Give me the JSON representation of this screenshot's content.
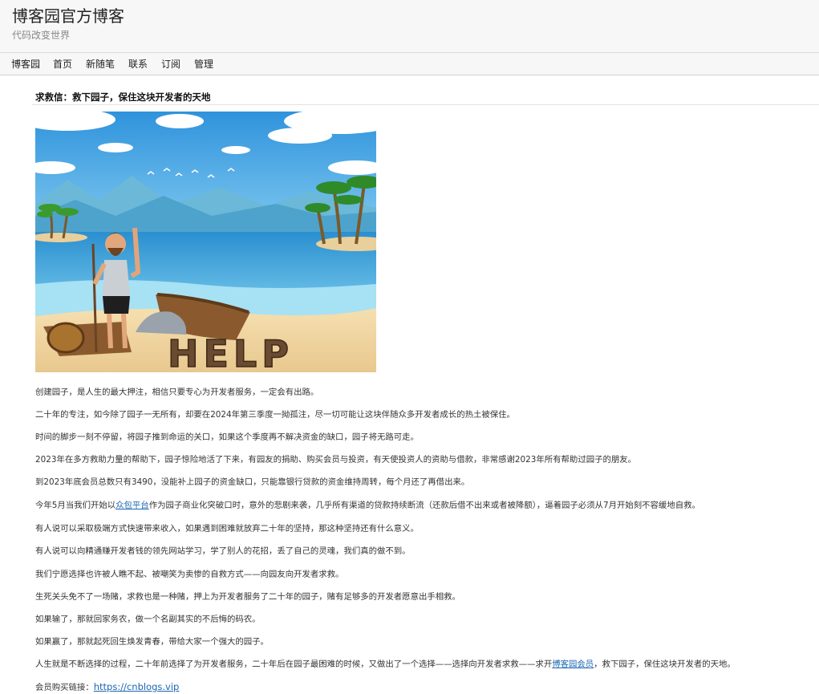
{
  "header": {
    "title": "博客园官方博客",
    "subtitle": "代码改变世界"
  },
  "nav": {
    "items": [
      "博客园",
      "首页",
      "新随笔",
      "联系",
      "订阅",
      "管理"
    ]
  },
  "post": {
    "title": "求救信：救下园子，保住这块开发者的天地",
    "image_text": "HELP",
    "paragraphs": [
      "创建园子，是人生的最大押注，相信只要专心为开发者服务，一定会有出路。",
      "二十年的专注，如今除了园子一无所有，却要在2024年第三季度一拗孤注，尽一切可能让这块伴随众多开发者成长的热土被保住。",
      "时间的脚步一刻不停留，将园子推到命运的关口，如果这个季度再不解决资金的缺口，园子将无路可走。",
      "2023年在多方救助力量的帮助下，园子惊险地活了下来，有园友的捐助、购买会员与投资，有天使投资人的资助与借款，非常感谢2023年所有帮助过园子的朋友。",
      "到2023年底会员总数只有3490，没能补上园子的资金缺口，只能靠银行贷款的资金维持周转，每个月还了再借出来。"
    ],
    "p6": {
      "before": "今年5月当我们开始以",
      "link": "众包平台",
      "after": "作为园子商业化突破口时，意外的悲剧来袭，几乎所有渠道的贷款持续断流（还款后借不出来或者被降额），逼着园子必须从7月开始刻不容缓地自救。"
    },
    "paragraphs2": [
      "有人说可以采取极端方式快速带来收入，如果遇到困难就放弃二十年的坚持，那这种坚持还有什么意义。",
      "有人说可以向精通赚开发者钱的领先网站学习，学了别人的花招，丢了自己的灵魂，我们真的做不到。",
      "我们宁愿选择也许被人瞧不起、被嘲笑为卖惨的自救方式——向园友向开发者求救。",
      "生死关头免不了一场赌，求救也是一种赌，押上为开发者服务了二十年的园子，赌有足够多的开发者愿意出手相救。",
      "如果输了，那就回家务农，做一个名副其实的不后悔的码农。",
      "如果赢了，那就起死回生焕发青春，带给大家一个强大的园子。"
    ],
    "p13": {
      "before": "人生就是不断选择的过程，二十年前选择了为开发者服务，二十年后在园子最困难的时候，又做出了一个选择——选择向开发者求救——求开",
      "link": "博客园会员",
      "after": "，救下园子，保住这块开发者的天地。"
    },
    "buy": {
      "label": "会员购买链接：",
      "link": "https://cnblogs.vip"
    }
  },
  "colors": {
    "link": "#1a66b3",
    "header_bg": "#f7f7f7"
  }
}
